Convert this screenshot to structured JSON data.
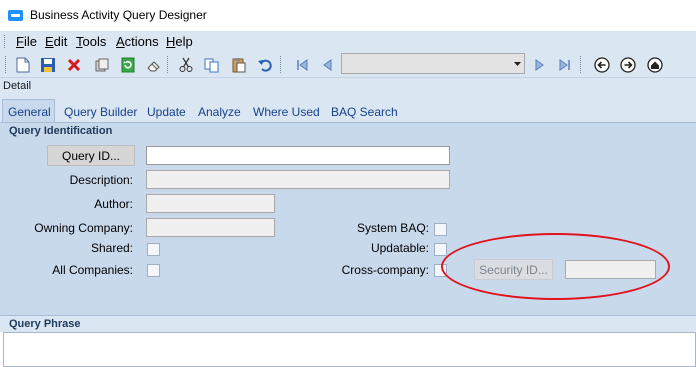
{
  "window": {
    "title": "Business Activity Query Designer"
  },
  "menu": [
    {
      "label": "File"
    },
    {
      "label": "Edit"
    },
    {
      "label": "Tools"
    },
    {
      "label": "Actions"
    },
    {
      "label": "Help"
    }
  ],
  "toolbar": {
    "icons": [
      "new-icon",
      "save-icon",
      "delete-icon",
      "copy-icon",
      "refresh-icon",
      "clear-icon",
      "cut-icon",
      "paste-copy-icon",
      "paste-icon",
      "undo-icon",
      "first-record-icon",
      "previous-record-icon",
      "next-record-icon",
      "last-record-icon",
      "back-icon",
      "forward-icon",
      "home-icon"
    ],
    "record_combo_value": ""
  },
  "detail_label": "Detail",
  "tabs": [
    {
      "label": "General",
      "active": true
    },
    {
      "label": "Query Builder"
    },
    {
      "label": "Update"
    },
    {
      "label": "Analyze"
    },
    {
      "label": "Where Used"
    },
    {
      "label": "BAQ Search"
    }
  ],
  "query_identification": {
    "section_title": "Query Identification",
    "query_id_button": "Query ID...",
    "query_id_value": "",
    "description_label": "Description:",
    "description_value": "",
    "author_label": "Author:",
    "author_value": "",
    "owning_company_label": "Owning Company:",
    "owning_company_value": "",
    "shared_label": "Shared:",
    "shared_checked": false,
    "all_companies_label": "All Companies:",
    "all_companies_checked": false,
    "system_baq_label": "System BAQ:",
    "system_baq_checked": false,
    "updatable_label": "Updatable:",
    "updatable_checked": false,
    "cross_company_label": "Cross-company:",
    "cross_company_checked": false,
    "security_id_button": "Security ID...",
    "security_id_value": ""
  },
  "query_phrase": {
    "section_title": "Query Phrase",
    "value": ""
  },
  "colors": {
    "highlight": "#e0141b",
    "panel": "#c9d9ec",
    "tab_text": "#15428b"
  }
}
